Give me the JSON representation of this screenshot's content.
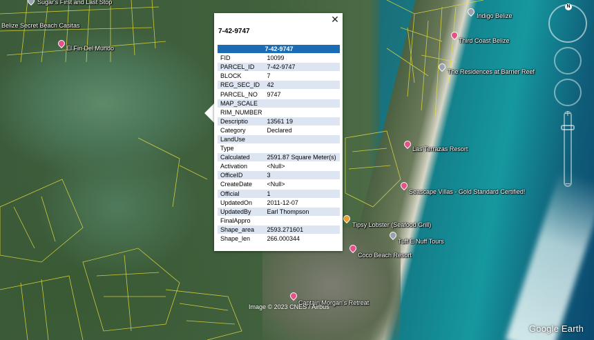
{
  "popup": {
    "title": "7-42-9747",
    "header_value": "7-42-9747",
    "close_glyph": "✕",
    "rows": [
      {
        "key": "FID",
        "value": "10099"
      },
      {
        "key": "PARCEL_ID",
        "value": "7-42-9747"
      },
      {
        "key": "BLOCK",
        "value": "7"
      },
      {
        "key": "REG_SEC_ID",
        "value": "42"
      },
      {
        "key": "PARCEL_NO",
        "value": "9747"
      },
      {
        "key": "MAP_SCALE",
        "value": ""
      },
      {
        "key": "RIM_NUMBER",
        "value": ""
      },
      {
        "key": "Descriptio",
        "value": "13561 19"
      },
      {
        "key": "Category",
        "value": "Declared"
      },
      {
        "key": "LandUse",
        "value": ""
      },
      {
        "key": "Type",
        "value": ""
      },
      {
        "key": "Calculated",
        "value": "2591.87 Square Meter(s)"
      },
      {
        "key": "Activation",
        "value": "<Null>"
      },
      {
        "key": "OfficeID",
        "value": "3"
      },
      {
        "key": "CreateDate",
        "value": "<Null>"
      },
      {
        "key": "Official",
        "value": "1"
      },
      {
        "key": "UpdatedOn",
        "value": "2011-12-07"
      },
      {
        "key": "UpdatedBy",
        "value": "Earl Thompson"
      },
      {
        "key": "FinalAppro",
        "value": ""
      },
      {
        "key": "Shape_area",
        "value": "2593.271601"
      },
      {
        "key": "Shape_len",
        "value": "266.000344"
      }
    ]
  },
  "places": [
    {
      "name": "Sugar's First and Last Stop",
      "icon": "gray-pin-icon"
    },
    {
      "name": "Belize Secret Beach Casitas",
      "icon": "none"
    },
    {
      "name": "El Fin Del Mundo",
      "icon": "pink-pin-icon"
    },
    {
      "name": "Indigo Belize",
      "icon": "gray-pin-icon"
    },
    {
      "name": "Third Coast Belize",
      "icon": "pink-pin-icon"
    },
    {
      "name": "The Residences at Barrier Reef",
      "icon": "gray-pin-icon"
    },
    {
      "name": "Las Terrazas Resort",
      "icon": "pink-pin-icon"
    },
    {
      "name": "Seascape Villas - Gold Standard Certified!",
      "icon": "pink-pin-icon"
    },
    {
      "name": "Tipsy Lobster (Seafood Grill)",
      "icon": "orange-pin-icon"
    },
    {
      "name": "Tuff E Nuff Tours",
      "icon": "gray-pin-icon"
    },
    {
      "name": "Coco Beach Resort",
      "icon": "pink-pin-icon"
    },
    {
      "name": "Captain Morgan's Retreat",
      "icon": "pink-pin-icon"
    }
  ],
  "credits": "Image © 2023 CNES / Airbus",
  "brand": "Google Earth",
  "nav": {
    "compass_label": "N",
    "zoom_in": "+",
    "zoom_out": "−"
  },
  "colors": {
    "popup_header": "#1a6db5",
    "row_alt": "#dde5f2",
    "parcel_lines": "#e8e040",
    "pin_pink": "#e8508a"
  }
}
